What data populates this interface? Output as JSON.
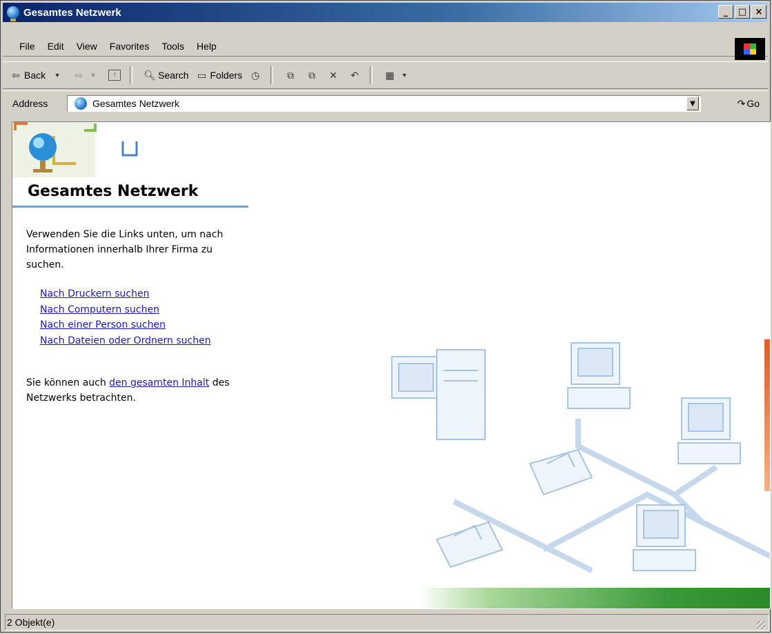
{
  "window": {
    "title": "Gesamtes Netzwerk",
    "controls": {
      "minimize": "_",
      "maximize": "□",
      "close": "×"
    }
  },
  "menubar": {
    "items": [
      "File",
      "Edit",
      "View",
      "Favorites",
      "Tools",
      "Help"
    ]
  },
  "toolbar": {
    "back": "Back",
    "search": "Search",
    "folders": "Folders"
  },
  "address": {
    "label": "Address",
    "value": "Gesamtes Netzwerk",
    "go": "Go"
  },
  "panel": {
    "title": "Gesamtes Netzwerk",
    "intro": "Verwenden Sie die Links unten, um nach Informationen innerhalb Ihrer Firma zu suchen.",
    "links": [
      "Nach Druckern suchen",
      "Nach Computern suchen",
      "Nach einer Person suchen",
      "Nach Dateien oder Ordnern suchen"
    ],
    "also_prefix": "Sie können auch ",
    "also_link": "den gesamten Inhalt",
    "also_suffix": " des Netzwerks betrachten."
  },
  "status": {
    "text": "2 Objekt(e)"
  },
  "colors": {
    "titlebar_start": "#0a246a",
    "titlebar_end": "#a6caf0",
    "link": "#1a1ab5",
    "chrome": "#d4d0c8"
  }
}
